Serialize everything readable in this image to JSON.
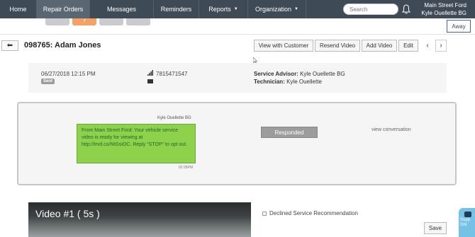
{
  "nav": {
    "items": [
      {
        "label": "Home"
      },
      {
        "label": "Repair Orders"
      },
      {
        "label": "Messages"
      },
      {
        "label": "Reminders"
      },
      {
        "label": "Reports"
      },
      {
        "label": "Organization"
      }
    ],
    "search_placeholder": "Search",
    "store_name": "Main Street Ford",
    "user_name": "Kyle Ouellette BG"
  },
  "subtabs": {
    "badge_count": "7"
  },
  "away_label": "Away",
  "repair_order": {
    "title": "098765: Adam Jones",
    "buttons": {
      "view_with_customer": "View with Customer",
      "resend_video": "Resend Video",
      "add_video": "Add Video",
      "edit": "Edit"
    }
  },
  "info": {
    "date": "06/27/2018 12:15 PM",
    "status": "Sent",
    "phone": "7815471547",
    "advisor_label": "Service Advisor:",
    "advisor_name": "Kyle Ouellette BG",
    "tech_label": "Technician:",
    "tech_name": "Kyle Ouellette"
  },
  "conversation": {
    "sender": "Kyle Ouellette BG",
    "message": "From Main Street Ford: Your vehicle service video is ready for viewing at http://trvd.co/NtGsiOC. Reply \"STOP\" to opt out.",
    "time": "02:26PM",
    "responded_label": "Responded",
    "view_conversation": "view conversation"
  },
  "video": {
    "title": "Video #1 ( 5s )",
    "declined_label": "Declined Service Recommendation",
    "save_label": "Save"
  },
  "support": {
    "label": "Supp Onl"
  },
  "colors": {
    "nav_bg": "#3f4a57",
    "bubble_green": "#8ed14a",
    "badge_orange": "#f4a167",
    "support_blue": "#76c1e6"
  }
}
